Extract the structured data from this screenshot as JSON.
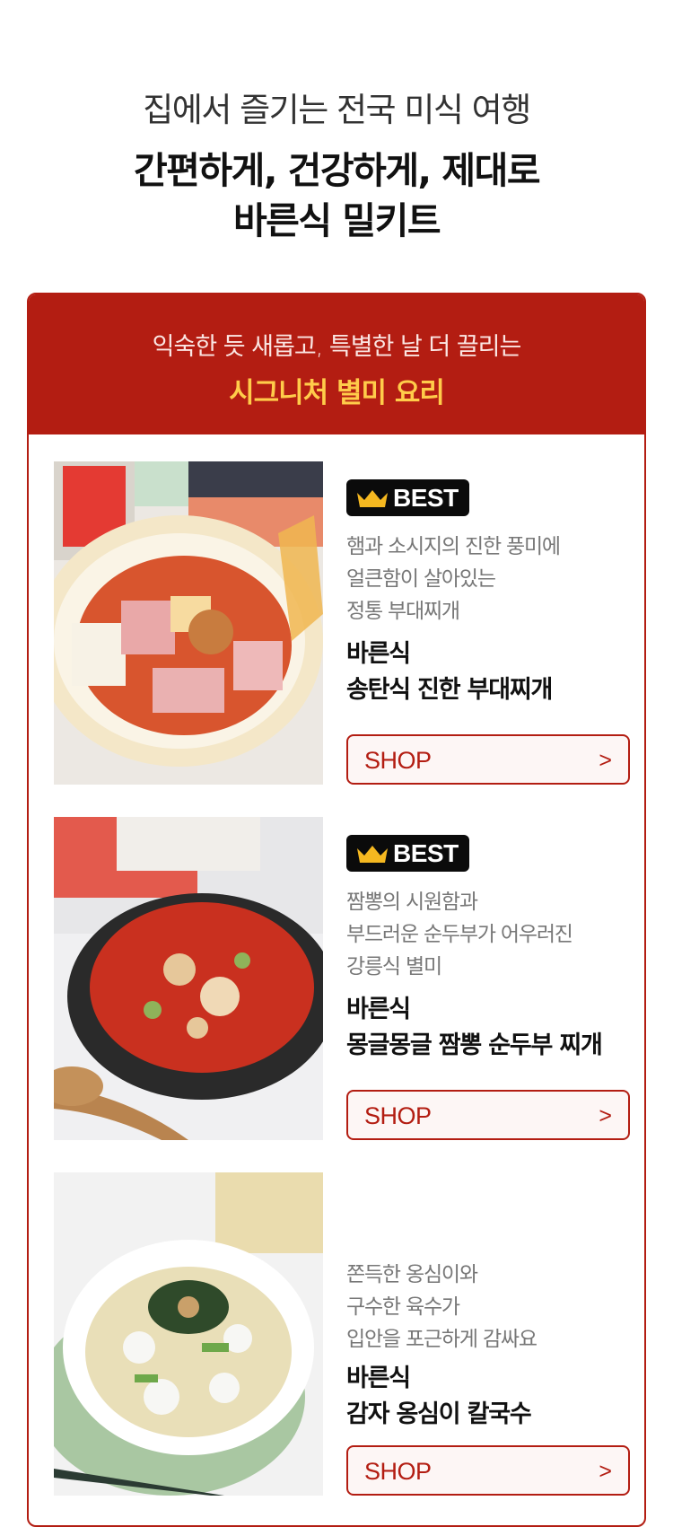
{
  "hero": {
    "subtitle": "집에서 즐기는 전국 미식 여행",
    "title_line1": "간편하게, 건강하게, 제대로",
    "title_line2": "바른식 밀키트"
  },
  "section": {
    "subtitle": "익숙한 듯 새롭고, 특별한 날 더 끌리는",
    "title": "시그니처 별미 요리"
  },
  "products": [
    {
      "badge": "BEST",
      "desc": [
        "햄과 소시지의 진한 풍미에",
        "얼큰함이 살아있는",
        "정통 부대찌개"
      ],
      "brand": "바른식",
      "name": "송탄식 진한 부대찌개",
      "button": "SHOP",
      "arrow": ">",
      "photo_icon": "budae-jjigae-photo"
    },
    {
      "badge": "BEST",
      "desc": [
        "짬뽕의 시원함과",
        "부드러운 순두부가 어우러진",
        "강릉식 별미"
      ],
      "brand": "바른식",
      "name": "몽글몽글 짬뽕 순두부 찌개",
      "button": "SHOP",
      "arrow": ">",
      "photo_icon": "sundubu-jjigae-photo"
    },
    {
      "badge": "",
      "desc": [
        "쫀득한 옹심이와",
        "구수한 육수가",
        "입안을 포근하게 감싸요"
      ],
      "brand": "바른식",
      "name": "감자 옹심이 칼국수",
      "button": "SHOP",
      "arrow": ">",
      "photo_icon": "ongsimi-kalguksu-photo"
    }
  ],
  "colors": {
    "brand_red": "#b31d12",
    "accent_yellow": "#ffcc4a",
    "badge_black": "#0b0b0b"
  }
}
